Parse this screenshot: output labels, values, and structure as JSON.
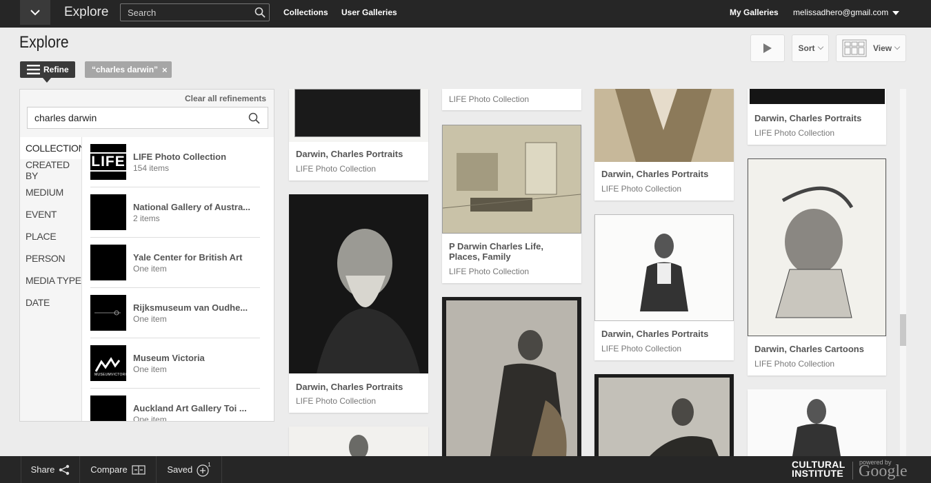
{
  "topbar": {
    "brand": "Explore",
    "search_placeholder": "Search",
    "links": [
      "Collections",
      "User Galleries"
    ],
    "my_galleries": "My Galleries",
    "user_email": "melissadhero@gmail.com"
  },
  "page": {
    "title": "Explore",
    "sort_label": "Sort",
    "view_label": "View"
  },
  "refine": {
    "button_label": "Refine",
    "chip_label": "“charles darwin”",
    "chip_close": "×",
    "clear_all": "Clear all refinements",
    "search_value": "charles darwin",
    "facets": [
      "COLLECTION",
      "CREATED BY",
      "MEDIUM",
      "EVENT",
      "PLACE",
      "PERSON",
      "MEDIA TYPE",
      "DATE"
    ],
    "collections": [
      {
        "name": "LIFE Photo Collection",
        "count": "154 items",
        "thumb_text": "LIFE"
      },
      {
        "name": "National Gallery of Austra...",
        "count": "2 items",
        "thumb_text": ""
      },
      {
        "name": "Yale Center for British Art",
        "count": "One item",
        "thumb_text": ""
      },
      {
        "name": "Rijksmuseum van Oudhe...",
        "count": "One item",
        "thumb_text": ""
      },
      {
        "name": "Museum Victoria",
        "count": "One item",
        "thumb_text": "MUSEUMVICTORIA"
      },
      {
        "name": "Auckland Art Gallery Toi ...",
        "count": "One item",
        "thumb_text": ""
      }
    ]
  },
  "cards": [
    {
      "title": "Darwin, Charles Portraits",
      "subtitle": "LIFE Photo Collection"
    },
    {
      "title": "Darwin, Charles Portraits",
      "subtitle": "LIFE Photo Collection"
    },
    {
      "title": "",
      "subtitle": "LIFE Photo Collection"
    },
    {
      "title": "P Darwin Charles Life, Places, Family",
      "subtitle": "LIFE Photo Collection"
    },
    {
      "title": "Darwin, Charles Portraits",
      "subtitle": "LIFE Photo Collection"
    },
    {
      "title": "Darwin, Charles Portraits",
      "subtitle": "LIFE Photo Collection"
    },
    {
      "title": "Darwin, Charles Portraits",
      "subtitle": "LIFE Photo Collection"
    },
    {
      "title": "Darwin, Charles Cartoons",
      "subtitle": "LIFE Photo Collection"
    }
  ],
  "bottombar": {
    "share": "Share",
    "compare": "Compare",
    "saved": "Saved",
    "saved_count": "1",
    "ci_line1": "CULTURAL",
    "ci_line2": "INSTITUTE",
    "powered_by": "powered by",
    "google": "Google"
  }
}
